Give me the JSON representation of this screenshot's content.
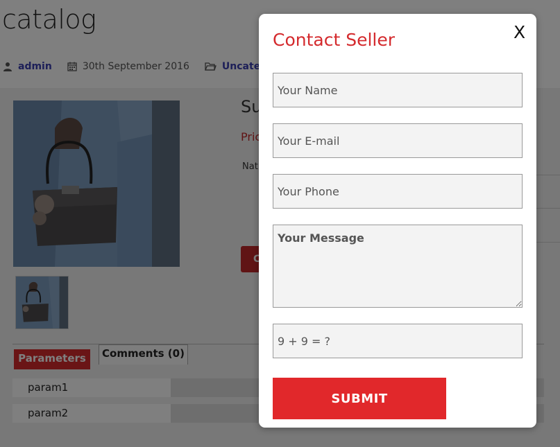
{
  "page": {
    "title": "catalog",
    "meta": {
      "author": "admin",
      "date": "30th September 2016",
      "category": "Uncategor"
    }
  },
  "product": {
    "title": "Su",
    "price_label": "Pric",
    "attr_label": "Nat",
    "button_label": "C"
  },
  "tabs": [
    {
      "label": "Parameters",
      "active": true
    },
    {
      "label": "Comments (0)",
      "active": false
    }
  ],
  "params": [
    {
      "name": "param1",
      "value": ""
    },
    {
      "name": "param2",
      "value": ""
    }
  ],
  "modal": {
    "title": "Contact Seller",
    "close": "X",
    "fields": {
      "name_placeholder": "Your Name",
      "email_placeholder": "Your E-mail",
      "phone_placeholder": "Your Phone",
      "message_placeholder": "Your Message",
      "captcha_placeholder": "9 + 9 = ?"
    },
    "submit": "SUBMIT"
  },
  "colors": {
    "accent": "#e1282b",
    "title_red": "#d42a2d",
    "link_blue": "#3a3fb0"
  },
  "icons": [
    "user-icon",
    "calendar-icon",
    "folder-icon",
    "close-icon"
  ]
}
